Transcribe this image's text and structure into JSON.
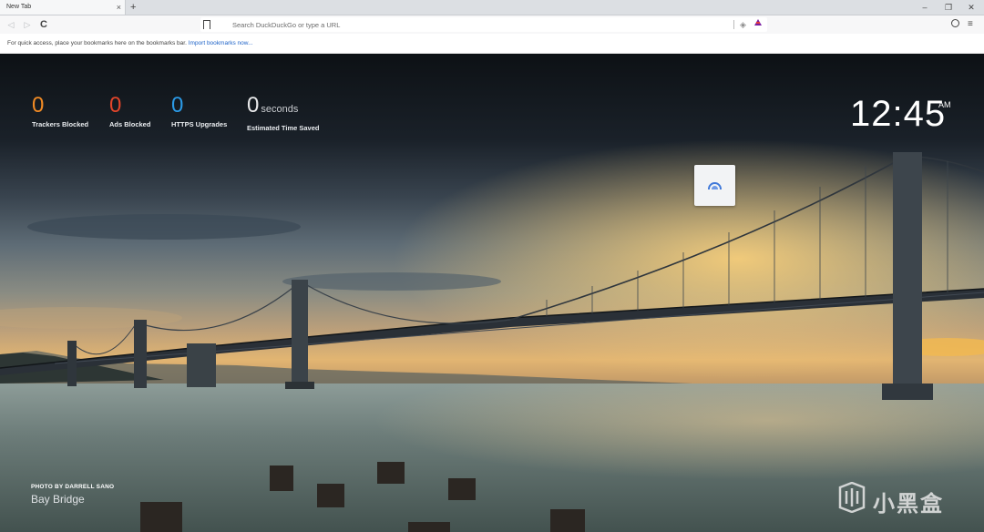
{
  "browser": {
    "tab_title": "New Tab",
    "tab_close": "×",
    "new_tab": "+",
    "window_controls": {
      "minimize": "–",
      "restore": "❐",
      "close": "✕"
    },
    "nav": {
      "back": "◁",
      "forward": "▷",
      "reload": "C"
    },
    "search": {
      "placeholder": "Search DuckDuckGo or type a URL",
      "value": ""
    },
    "shield": "◈",
    "menu": "≡"
  },
  "bookmarks_bar": {
    "message": "For quick access, place your bookmarks here on the bookmarks bar.",
    "import_link": "Import bookmarks now..."
  },
  "stats": [
    {
      "value": "0",
      "unit": "",
      "label": "Trackers Blocked",
      "color": "#f08a24"
    },
    {
      "value": "0",
      "unit": "",
      "label": "Ads Blocked",
      "color": "#e2452a"
    },
    {
      "value": "0",
      "unit": "",
      "label": "HTTPS Upgrades",
      "color": "#2b9ae6"
    },
    {
      "value": "0",
      "unit": "seconds",
      "label": "Estimated Time Saved",
      "color": "#e8e9ea"
    }
  ],
  "clock": {
    "time": "12:45",
    "ampm": "AM"
  },
  "photo_credit": {
    "by": "PHOTO BY DARRELL SANO",
    "title": "Bay Bridge"
  },
  "watermark": {
    "text": "小黑盒"
  }
}
